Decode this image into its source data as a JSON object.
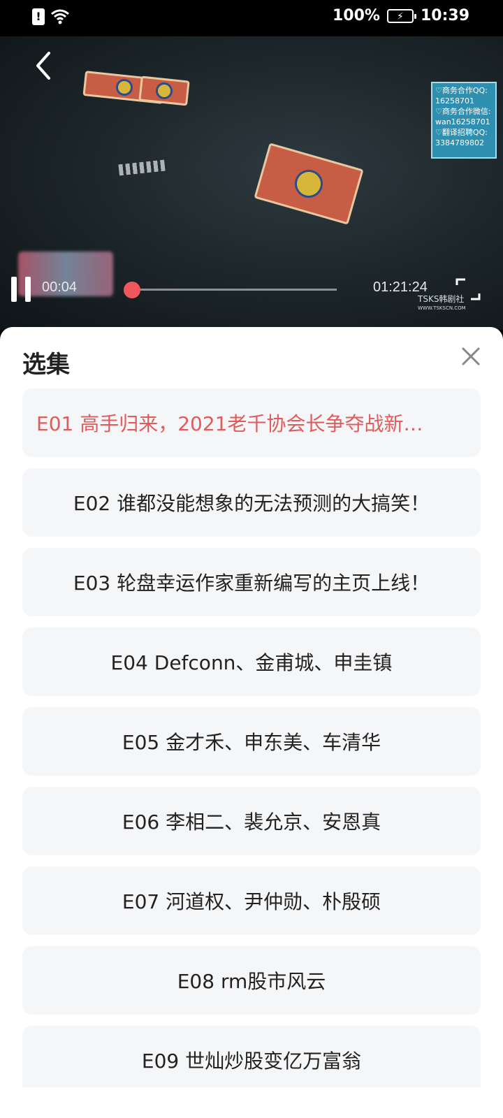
{
  "status_bar": {
    "battery_text": "100%",
    "time": "10:39"
  },
  "player": {
    "current_time": "00:04",
    "duration": "01:21:24",
    "progress_fraction": 0.003,
    "overlay_ad_lines": [
      "♡商务合作QQ:",
      "16258701",
      "♡商务合作微信:",
      "wan16258701",
      "♡翻译招聘QQ:",
      "3384789802"
    ],
    "watermark": "TSKS韩剧社",
    "watermark_sub": "WWW.TSKSCN.COM"
  },
  "sheet": {
    "title": "选集",
    "episodes": [
      {
        "label": "E01 高手归来，2021老千协会长争夺战新…",
        "active": true
      },
      {
        "label": "E02 谁都没能想象的无法预测的大搞笑！",
        "active": false
      },
      {
        "label": "E03 轮盘幸运作家重新编写的主页上线！",
        "active": false
      },
      {
        "label": "E04 Defconn、金甫城、申圭镇",
        "active": false
      },
      {
        "label": "E05 金才禾、申东美、车清华",
        "active": false
      },
      {
        "label": "E06 李相二、裴允京、安恩真",
        "active": false
      },
      {
        "label": "E07 河道权、尹仲勋、朴殷硕",
        "active": false
      },
      {
        "label": "E08 rm股市风云",
        "active": false
      },
      {
        "label": "E09 世灿炒股变亿万富翁",
        "active": false
      }
    ]
  },
  "colors": {
    "accent": "#e25b5b",
    "seek_thumb": "#f0575c",
    "item_bg": "#f5f6f8"
  }
}
